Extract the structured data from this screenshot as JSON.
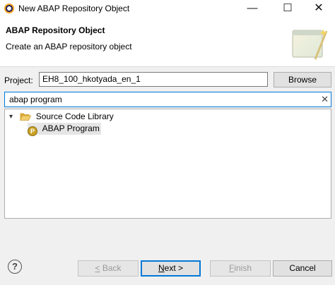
{
  "window": {
    "title": "New ABAP Repository Object",
    "minimize": "—",
    "maximize": "☐",
    "close": "✕"
  },
  "header": {
    "title": "ABAP Repository Object",
    "description": "Create an ABAP repository object"
  },
  "project": {
    "label": "Project:",
    "value": "EH8_100_hkotyada_en_1",
    "browse_label": "Browse"
  },
  "search": {
    "value": "abap program",
    "clear_glyph": "✕"
  },
  "tree": {
    "folder": {
      "expand_glyph": "▾",
      "label": "Source Code Library"
    },
    "item": {
      "label": "ABAP Program",
      "icon_letter": "P"
    }
  },
  "footer": {
    "help_glyph": "?",
    "back": {
      "mnemonic": "<",
      "rest": " Back"
    },
    "next": {
      "mnemonic": "N",
      "rest": "ext >"
    },
    "finish": {
      "mnemonic": "F",
      "rest": "inish"
    },
    "cancel_label": "Cancel"
  },
  "colors": {
    "accent": "#0078d7",
    "folder": "#e8c566",
    "program_icon": "#c9a227",
    "selection": "#e5e5e5"
  }
}
